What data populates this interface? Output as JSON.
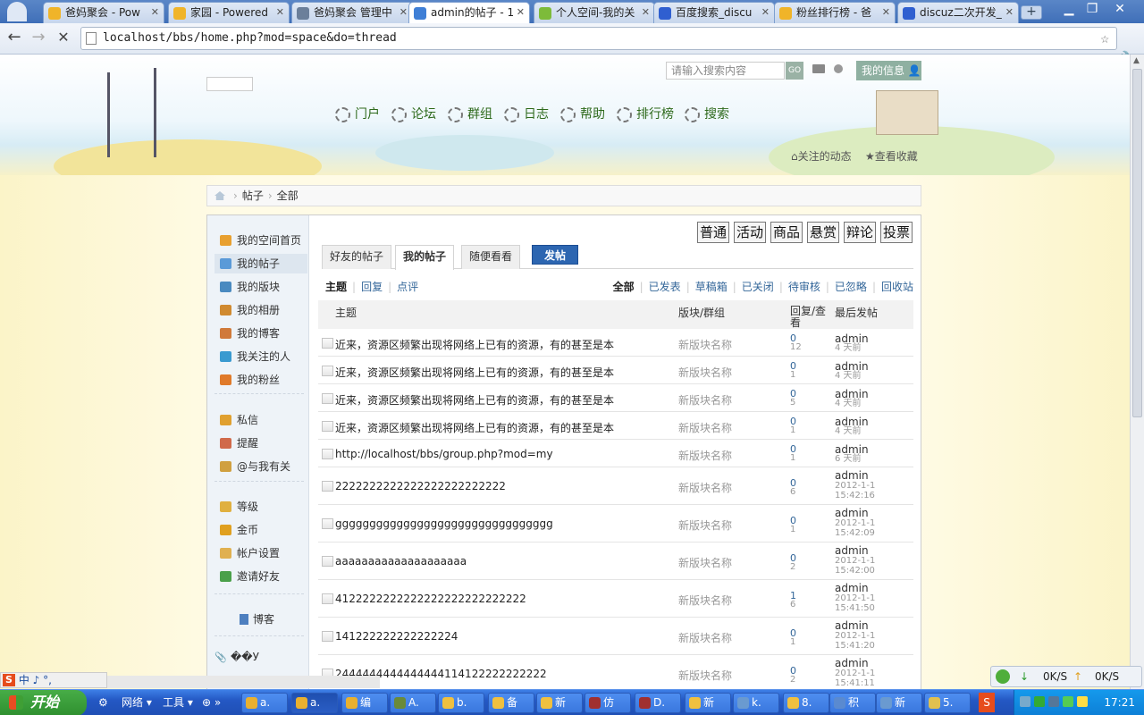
{
  "browser": {
    "tabs": [
      {
        "label": "爸妈聚会 - Pow",
        "color": "#f0b429"
      },
      {
        "label": "家园 - Powered",
        "color": "#f0b429"
      },
      {
        "label": "爸妈聚会 管理中",
        "color": "#6b7f9a"
      },
      {
        "label": "admin的帖子 - 1",
        "color": "#3f7fd6"
      },
      {
        "label": "个人空间-我的关",
        "color": "#7dbb3a"
      },
      {
        "label": "百度搜索_discu",
        "color": "#2f5fd0"
      },
      {
        "label": "粉丝排行榜 - 爸",
        "color": "#f0b429"
      },
      {
        "label": "discuz二次开发_",
        "color": "#2f5fd0"
      }
    ],
    "new_tab": "+",
    "url": "localhost/bbs/home.php?mod=space&do=thread",
    "window_controls": [
      "▁",
      "❐",
      "✕"
    ]
  },
  "header": {
    "search_placeholder": "请输入搜索内容",
    "go_label": "GO",
    "my_info_label": "我的信息",
    "nav": [
      "门户",
      "论坛",
      "群组",
      "日志",
      "帮助",
      "排行榜",
      "搜索"
    ],
    "follow_label": "关注的动态",
    "favorite_label": "查看收藏"
  },
  "breadcrumb": {
    "items": [
      "帖子",
      "全部"
    ]
  },
  "sidebar": {
    "items": [
      {
        "label": "我的空间首页",
        "color": "#e8a030"
      },
      {
        "label": "我的帖子",
        "color": "#5a9ad8"
      },
      {
        "label": "我的版块",
        "color": "#4a8ac0"
      },
      {
        "label": "我的相册",
        "color": "#d08a30"
      },
      {
        "label": "我的博客",
        "color": "#d07a3a"
      },
      {
        "label": "我关注的人",
        "color": "#3a9ad0"
      },
      {
        "label": "我的粉丝",
        "color": "#e07a2a"
      },
      {
        "label": "私信",
        "color": "#e0a030"
      },
      {
        "label": "提醒",
        "color": "#d06a4a"
      },
      {
        "label": "@与我有关",
        "color": "#d0a040"
      },
      {
        "label": "等级",
        "color": "#e0b040"
      },
      {
        "label": "金币",
        "color": "#e0a020"
      },
      {
        "label": "帐户设置",
        "color": "#e0b050"
      },
      {
        "label": "邀请好友",
        "color": "#4aa04a"
      }
    ],
    "blog_label": "博客",
    "misc_label": "��У"
  },
  "content": {
    "type_buttons": [
      "普通",
      "活动",
      "商品",
      "悬赏",
      "辩论",
      "投票"
    ],
    "subtabs": [
      "好友的帖子",
      "我的帖子",
      "随便看看"
    ],
    "post_button": "发帖",
    "filter_left": [
      "主题",
      "回复",
      "点评"
    ],
    "filter_right": [
      "全部",
      "已发表",
      "草稿箱",
      "已关闭",
      "待审核",
      "已忽略",
      "回收站"
    ],
    "columns": {
      "subject": "主题",
      "forum": "版块/群组",
      "stats": "回复/查看",
      "last": "最后发帖"
    },
    "rows": [
      {
        "title": "近来，资源区频繁出现将网络上已有的资源，有的甚至是本",
        "forum": "新版块名称",
        "replies": "0",
        "views": "12",
        "author": "admin",
        "time": "4 天前"
      },
      {
        "title": "近来，资源区频繁出现将网络上已有的资源，有的甚至是本",
        "forum": "新版块名称",
        "replies": "0",
        "views": "1",
        "author": "admin",
        "time": "4 天前"
      },
      {
        "title": "近来，资源区频繁出现将网络上已有的资源，有的甚至是本",
        "forum": "新版块名称",
        "replies": "0",
        "views": "5",
        "author": "admin",
        "time": "4 天前"
      },
      {
        "title": "近来，资源区频繁出现将网络上已有的资源，有的甚至是本",
        "forum": "新版块名称",
        "replies": "0",
        "views": "1",
        "author": "admin",
        "time": "4 天前"
      },
      {
        "title": "http://localhost/bbs/group.php?mod=my",
        "forum": "新版块名称",
        "replies": "0",
        "views": "1",
        "author": "admin",
        "time": "6 天前"
      },
      {
        "title": "2222222222222222222222222",
        "forum": "新版块名称",
        "replies": "0",
        "views": "6",
        "author": "admin",
        "time": "2012-1-1 15:42:16"
      },
      {
        "title": "gggggggggggggggggggggggggggggggg",
        "forum": "新版块名称",
        "replies": "0",
        "views": "1",
        "author": "admin",
        "time": "2012-1-1 15:42:09"
      },
      {
        "title": "aaaaaaaaaaaaaaaaaaaa",
        "forum": "新版块名称",
        "replies": "0",
        "views": "2",
        "author": "admin",
        "time": "2012-1-1 15:42:00"
      },
      {
        "title": "4122222222222222222222222222",
        "forum": "新版块名称",
        "replies": "1",
        "views": "6",
        "author": "admin",
        "time": "2012-1-1 15:41:50"
      },
      {
        "title": "141222222222222224",
        "forum": "新版块名称",
        "replies": "0",
        "views": "1",
        "author": "admin",
        "time": "2012-1-1 15:41:20"
      },
      {
        "title": "2444444444444444114122222222222",
        "forum": "新版块名称",
        "replies": "0",
        "views": "2",
        "author": "admin",
        "time": "2012-1-1 15:41:11"
      }
    ]
  },
  "os": {
    "ime": "中 ♪ °,",
    "net_down": "0K/S",
    "net_up": "0K/S",
    "start_label": "开始",
    "quicklaunch": [
      "网络",
      "工具"
    ],
    "tasks": [
      {
        "label": "a.",
        "color": "#e8b030"
      },
      {
        "label": "a.",
        "color": "#e8b030"
      },
      {
        "label": "编",
        "color": "#e8b030"
      },
      {
        "label": "A.",
        "color": "#6a8a3a"
      },
      {
        "label": "b.",
        "color": "#f0c040"
      },
      {
        "label": "备",
        "color": "#f0c040"
      },
      {
        "label": "新",
        "color": "#f0c040"
      },
      {
        "label": "仿",
        "color": "#a03030"
      },
      {
        "label": "D.",
        "color": "#a03030"
      },
      {
        "label": "新",
        "color": "#f0c040"
      },
      {
        "label": "k.",
        "color": "#6a9ad0"
      },
      {
        "label": "8.",
        "color": "#f0c040"
      },
      {
        "label": "积",
        "color": "#5a8ad0"
      },
      {
        "label": "新",
        "color": "#6a9ad0"
      },
      {
        "label": "5.",
        "color": "#e0c050"
      }
    ],
    "clock": "17:21"
  }
}
